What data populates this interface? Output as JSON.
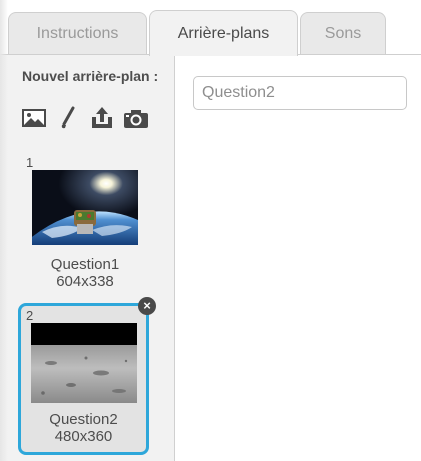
{
  "tabs": [
    {
      "label": "Instructions",
      "active": false
    },
    {
      "label": "Arrière-plans",
      "active": true
    },
    {
      "label": "Sons",
      "active": false
    }
  ],
  "new_backdrop": {
    "title": "Nouvel arrière-plan :",
    "tools": [
      "image-library-icon",
      "paint-brush-icon",
      "upload-icon",
      "camera-icon"
    ]
  },
  "backdrops": [
    {
      "number": "1",
      "name": "Question1",
      "size": "604x338",
      "selected": false
    },
    {
      "number": "2",
      "name": "Question2",
      "size": "480x360",
      "selected": true
    }
  ],
  "name_field": {
    "value": "Question2"
  },
  "colors": {
    "selected_border": "#2ea7da",
    "panel_bg": "#f2f2f2",
    "tab_bg": "#e9e9e9"
  }
}
